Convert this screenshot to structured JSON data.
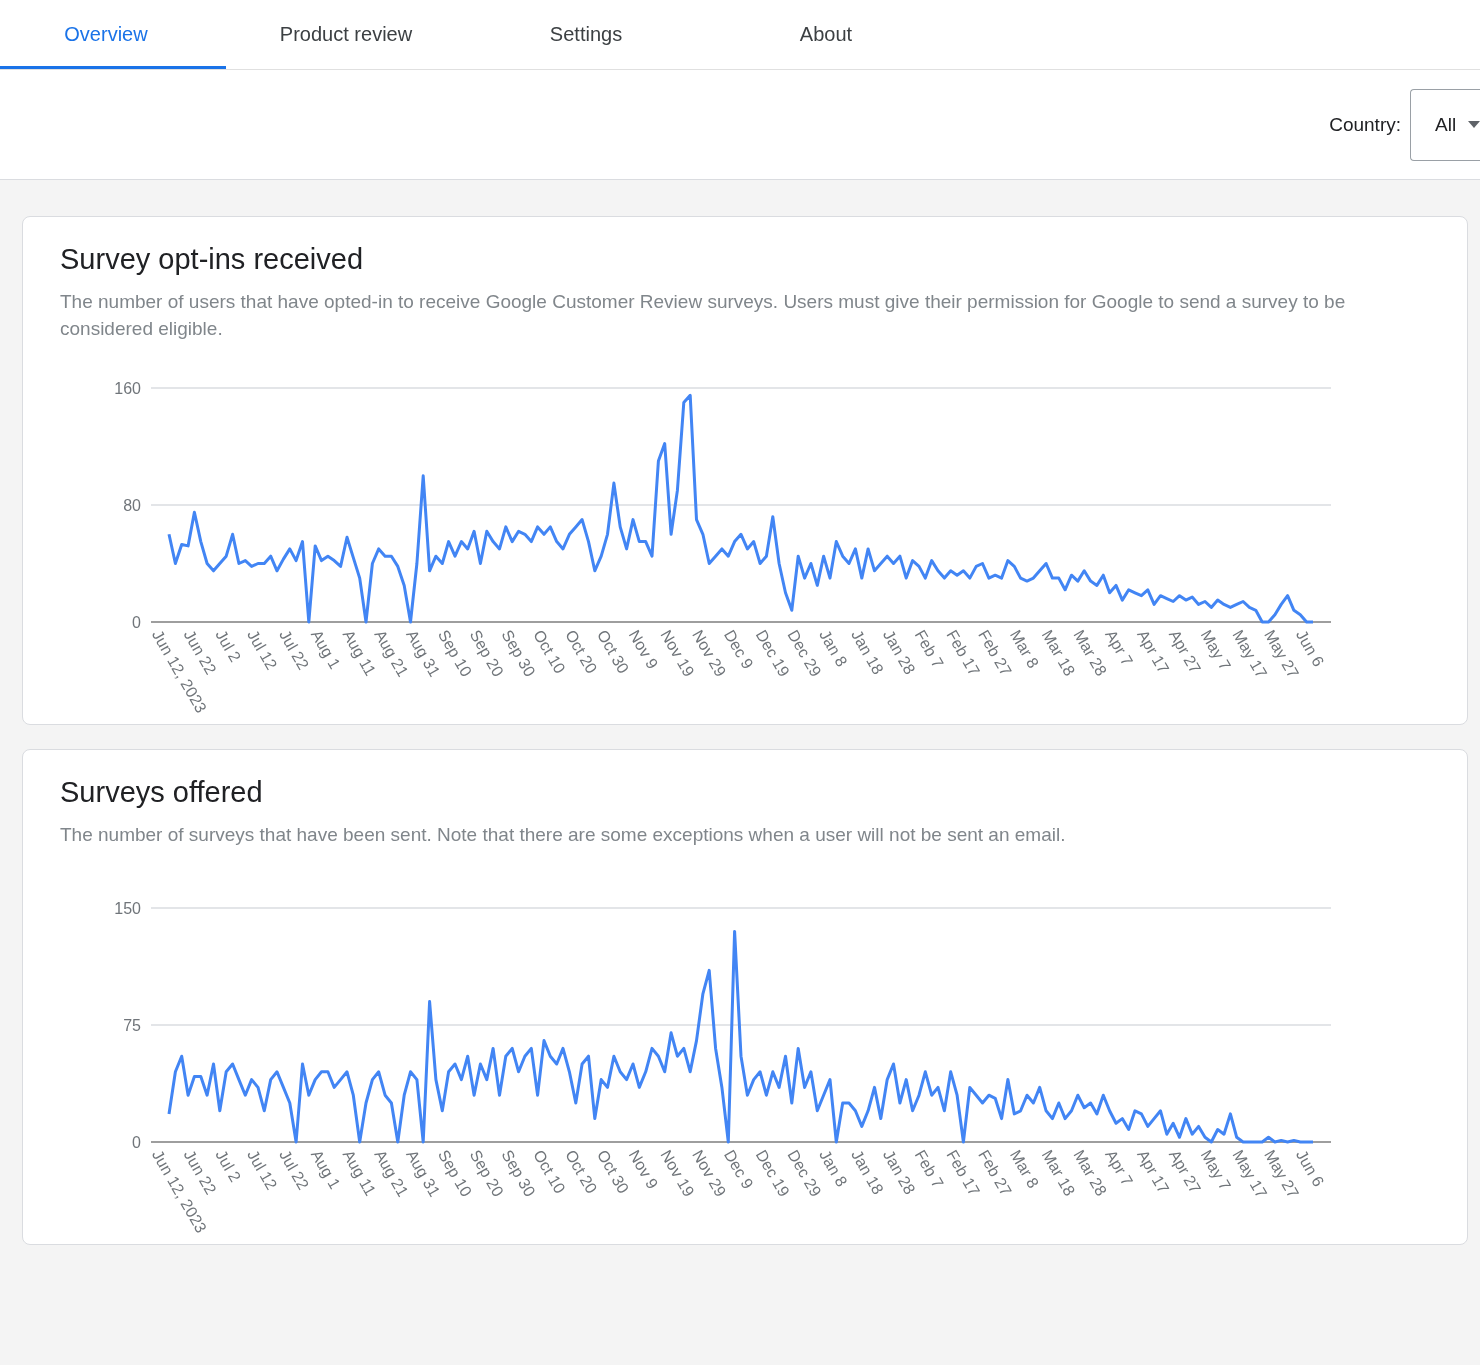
{
  "tabs": [
    {
      "label": "Overview",
      "selected": true
    },
    {
      "label": "Product review",
      "selected": false
    },
    {
      "label": "Settings",
      "selected": false
    },
    {
      "label": "About",
      "selected": false
    }
  ],
  "filter": {
    "label": "Country:",
    "value": "All"
  },
  "cards": [
    {
      "title": "Survey opt-ins received",
      "description": "The number of users that have opted-in to receive Google Customer Review surveys. Users must give their permission for Google to send a survey to be considered eligible.",
      "chart_data": {
        "type": "line",
        "ylim": [
          0,
          160
        ],
        "yticks": [
          0,
          80,
          160
        ],
        "categories": [
          "Jun 12, 2023",
          null,
          null,
          null,
          null,
          "Jun 22",
          null,
          null,
          null,
          null,
          "Jul 2",
          null,
          null,
          null,
          null,
          "Jul 12",
          null,
          null,
          null,
          null,
          "Jul 22",
          null,
          null,
          null,
          null,
          "Aug 1",
          null,
          null,
          null,
          null,
          "Aug 11",
          null,
          null,
          null,
          null,
          "Aug 21",
          null,
          null,
          null,
          null,
          "Aug 31",
          null,
          null,
          null,
          null,
          "Sep 10",
          null,
          null,
          null,
          null,
          "Sep 20",
          null,
          null,
          null,
          null,
          "Sep 30",
          null,
          null,
          null,
          null,
          "Oct 10",
          null,
          null,
          null,
          null,
          "Oct 20",
          null,
          null,
          null,
          null,
          "Oct 30",
          null,
          null,
          null,
          null,
          "Nov 9",
          null,
          null,
          null,
          null,
          "Nov 19",
          null,
          null,
          null,
          null,
          "Nov 29",
          null,
          null,
          null,
          null,
          "Dec 9",
          null,
          null,
          null,
          null,
          "Dec 19",
          null,
          null,
          null,
          null,
          "Dec 29",
          null,
          null,
          null,
          null,
          "Jan 8",
          null,
          null,
          null,
          null,
          "Jan 18",
          null,
          null,
          null,
          null,
          "Jan 28",
          null,
          null,
          null,
          null,
          "Feb 7",
          null,
          null,
          null,
          null,
          "Feb 17",
          null,
          null,
          null,
          null,
          "Feb 27",
          null,
          null,
          null,
          null,
          "Mar 8",
          null,
          null,
          null,
          null,
          "Mar 18",
          null,
          null,
          null,
          null,
          "Mar 28",
          null,
          null,
          null,
          null,
          "Apr 7",
          null,
          null,
          null,
          null,
          "Apr 17",
          null,
          null,
          null,
          null,
          "Apr 27",
          null,
          null,
          null,
          null,
          "May 7",
          null,
          null,
          null,
          null,
          "May 17",
          null,
          null,
          null,
          null,
          "May 27",
          null,
          null,
          null,
          null,
          "Jun 6"
        ],
        "series": [
          {
            "color": "#4285f4",
            "values": [
              60,
              40,
              53,
              52,
              75,
              55,
              40,
              35,
              40,
              45,
              60,
              40,
              42,
              38,
              40,
              40,
              45,
              35,
              43,
              50,
              42,
              55,
              0,
              52,
              42,
              45,
              42,
              38,
              58,
              44,
              30,
              0,
              40,
              50,
              45,
              45,
              38,
              25,
              0,
              40,
              100,
              35,
              45,
              40,
              55,
              45,
              55,
              50,
              62,
              40,
              62,
              55,
              50,
              65,
              55,
              62,
              60,
              55,
              65,
              60,
              65,
              55,
              50,
              60,
              65,
              70,
              55,
              35,
              45,
              60,
              95,
              65,
              50,
              70,
              55,
              55,
              45,
              110,
              122,
              60,
              90,
              150,
              155,
              70,
              60,
              40,
              45,
              50,
              45,
              55,
              60,
              50,
              55,
              40,
              45,
              72,
              40,
              20,
              8,
              45,
              30,
              40,
              25,
              45,
              30,
              55,
              45,
              40,
              50,
              30,
              50,
              35,
              40,
              45,
              40,
              45,
              30,
              42,
              38,
              30,
              42,
              35,
              30,
              35,
              32,
              35,
              30,
              38,
              40,
              30,
              32,
              30,
              42,
              38,
              30,
              28,
              30,
              35,
              40,
              30,
              30,
              22,
              32,
              28,
              35,
              28,
              25,
              32,
              20,
              25,
              15,
              22,
              20,
              18,
              22,
              12,
              18,
              16,
              14,
              18,
              15,
              17,
              12,
              14,
              10,
              15,
              12,
              10,
              12,
              14,
              10,
              8,
              0,
              0,
              5,
              12,
              18,
              8,
              5,
              0,
              0
            ]
          }
        ]
      }
    },
    {
      "title": "Surveys offered",
      "description": "The number of surveys that have been sent. Note that there are some exceptions when a user will not be sent an email.",
      "chart_data": {
        "type": "line",
        "ylim": [
          0,
          150
        ],
        "yticks": [
          0,
          75,
          150
        ],
        "categories": [
          "Jun 12, 2023",
          null,
          null,
          null,
          null,
          "Jun 22",
          null,
          null,
          null,
          null,
          "Jul 2",
          null,
          null,
          null,
          null,
          "Jul 12",
          null,
          null,
          null,
          null,
          "Jul 22",
          null,
          null,
          null,
          null,
          "Aug 1",
          null,
          null,
          null,
          null,
          "Aug 11",
          null,
          null,
          null,
          null,
          "Aug 21",
          null,
          null,
          null,
          null,
          "Aug 31",
          null,
          null,
          null,
          null,
          "Sep 10",
          null,
          null,
          null,
          null,
          "Sep 20",
          null,
          null,
          null,
          null,
          "Sep 30",
          null,
          null,
          null,
          null,
          "Oct 10",
          null,
          null,
          null,
          null,
          "Oct 20",
          null,
          null,
          null,
          null,
          "Oct 30",
          null,
          null,
          null,
          null,
          "Nov 9",
          null,
          null,
          null,
          null,
          "Nov 19",
          null,
          null,
          null,
          null,
          "Nov 29",
          null,
          null,
          null,
          null,
          "Dec 9",
          null,
          null,
          null,
          null,
          "Dec 19",
          null,
          null,
          null,
          null,
          "Dec 29",
          null,
          null,
          null,
          null,
          "Jan 8",
          null,
          null,
          null,
          null,
          "Jan 18",
          null,
          null,
          null,
          null,
          "Jan 28",
          null,
          null,
          null,
          null,
          "Feb 7",
          null,
          null,
          null,
          null,
          "Feb 17",
          null,
          null,
          null,
          null,
          "Feb 27",
          null,
          null,
          null,
          null,
          "Mar 8",
          null,
          null,
          null,
          null,
          "Mar 18",
          null,
          null,
          null,
          null,
          "Mar 28",
          null,
          null,
          null,
          null,
          "Apr 7",
          null,
          null,
          null,
          null,
          "Apr 17",
          null,
          null,
          null,
          null,
          "Apr 27",
          null,
          null,
          null,
          null,
          "May 7",
          null,
          null,
          null,
          null,
          "May 17",
          null,
          null,
          null,
          null,
          "May 27",
          null,
          null,
          null,
          null,
          "Jun 6"
        ],
        "series": [
          {
            "color": "#4285f4",
            "values": [
              18,
              45,
              55,
              30,
              42,
              42,
              30,
              50,
              20,
              45,
              50,
              40,
              30,
              40,
              35,
              20,
              40,
              45,
              35,
              25,
              0,
              50,
              30,
              40,
              45,
              45,
              35,
              40,
              45,
              30,
              0,
              25,
              40,
              45,
              30,
              25,
              0,
              30,
              45,
              40,
              0,
              90,
              40,
              20,
              45,
              50,
              40,
              55,
              30,
              50,
              40,
              60,
              30,
              55,
              60,
              45,
              55,
              60,
              30,
              65,
              55,
              50,
              60,
              45,
              25,
              50,
              55,
              15,
              40,
              35,
              55,
              45,
              40,
              50,
              35,
              45,
              60,
              55,
              45,
              70,
              55,
              60,
              45,
              65,
              95,
              110,
              60,
              35,
              0,
              135,
              55,
              30,
              40,
              45,
              30,
              45,
              35,
              55,
              25,
              60,
              35,
              45,
              20,
              30,
              40,
              0,
              25,
              25,
              20,
              10,
              20,
              35,
              15,
              40,
              50,
              25,
              40,
              20,
              30,
              45,
              30,
              35,
              20,
              45,
              30,
              0,
              35,
              30,
              25,
              30,
              28,
              15,
              40,
              18,
              20,
              30,
              25,
              35,
              20,
              15,
              25,
              15,
              20,
              30,
              22,
              25,
              18,
              30,
              20,
              12,
              15,
              8,
              20,
              18,
              10,
              15,
              20,
              5,
              12,
              3,
              15,
              5,
              10,
              3,
              0,
              8,
              5,
              18,
              3,
              0,
              0,
              0,
              0,
              3,
              0,
              1,
              0,
              1,
              0,
              0,
              0
            ]
          }
        ]
      }
    }
  ]
}
